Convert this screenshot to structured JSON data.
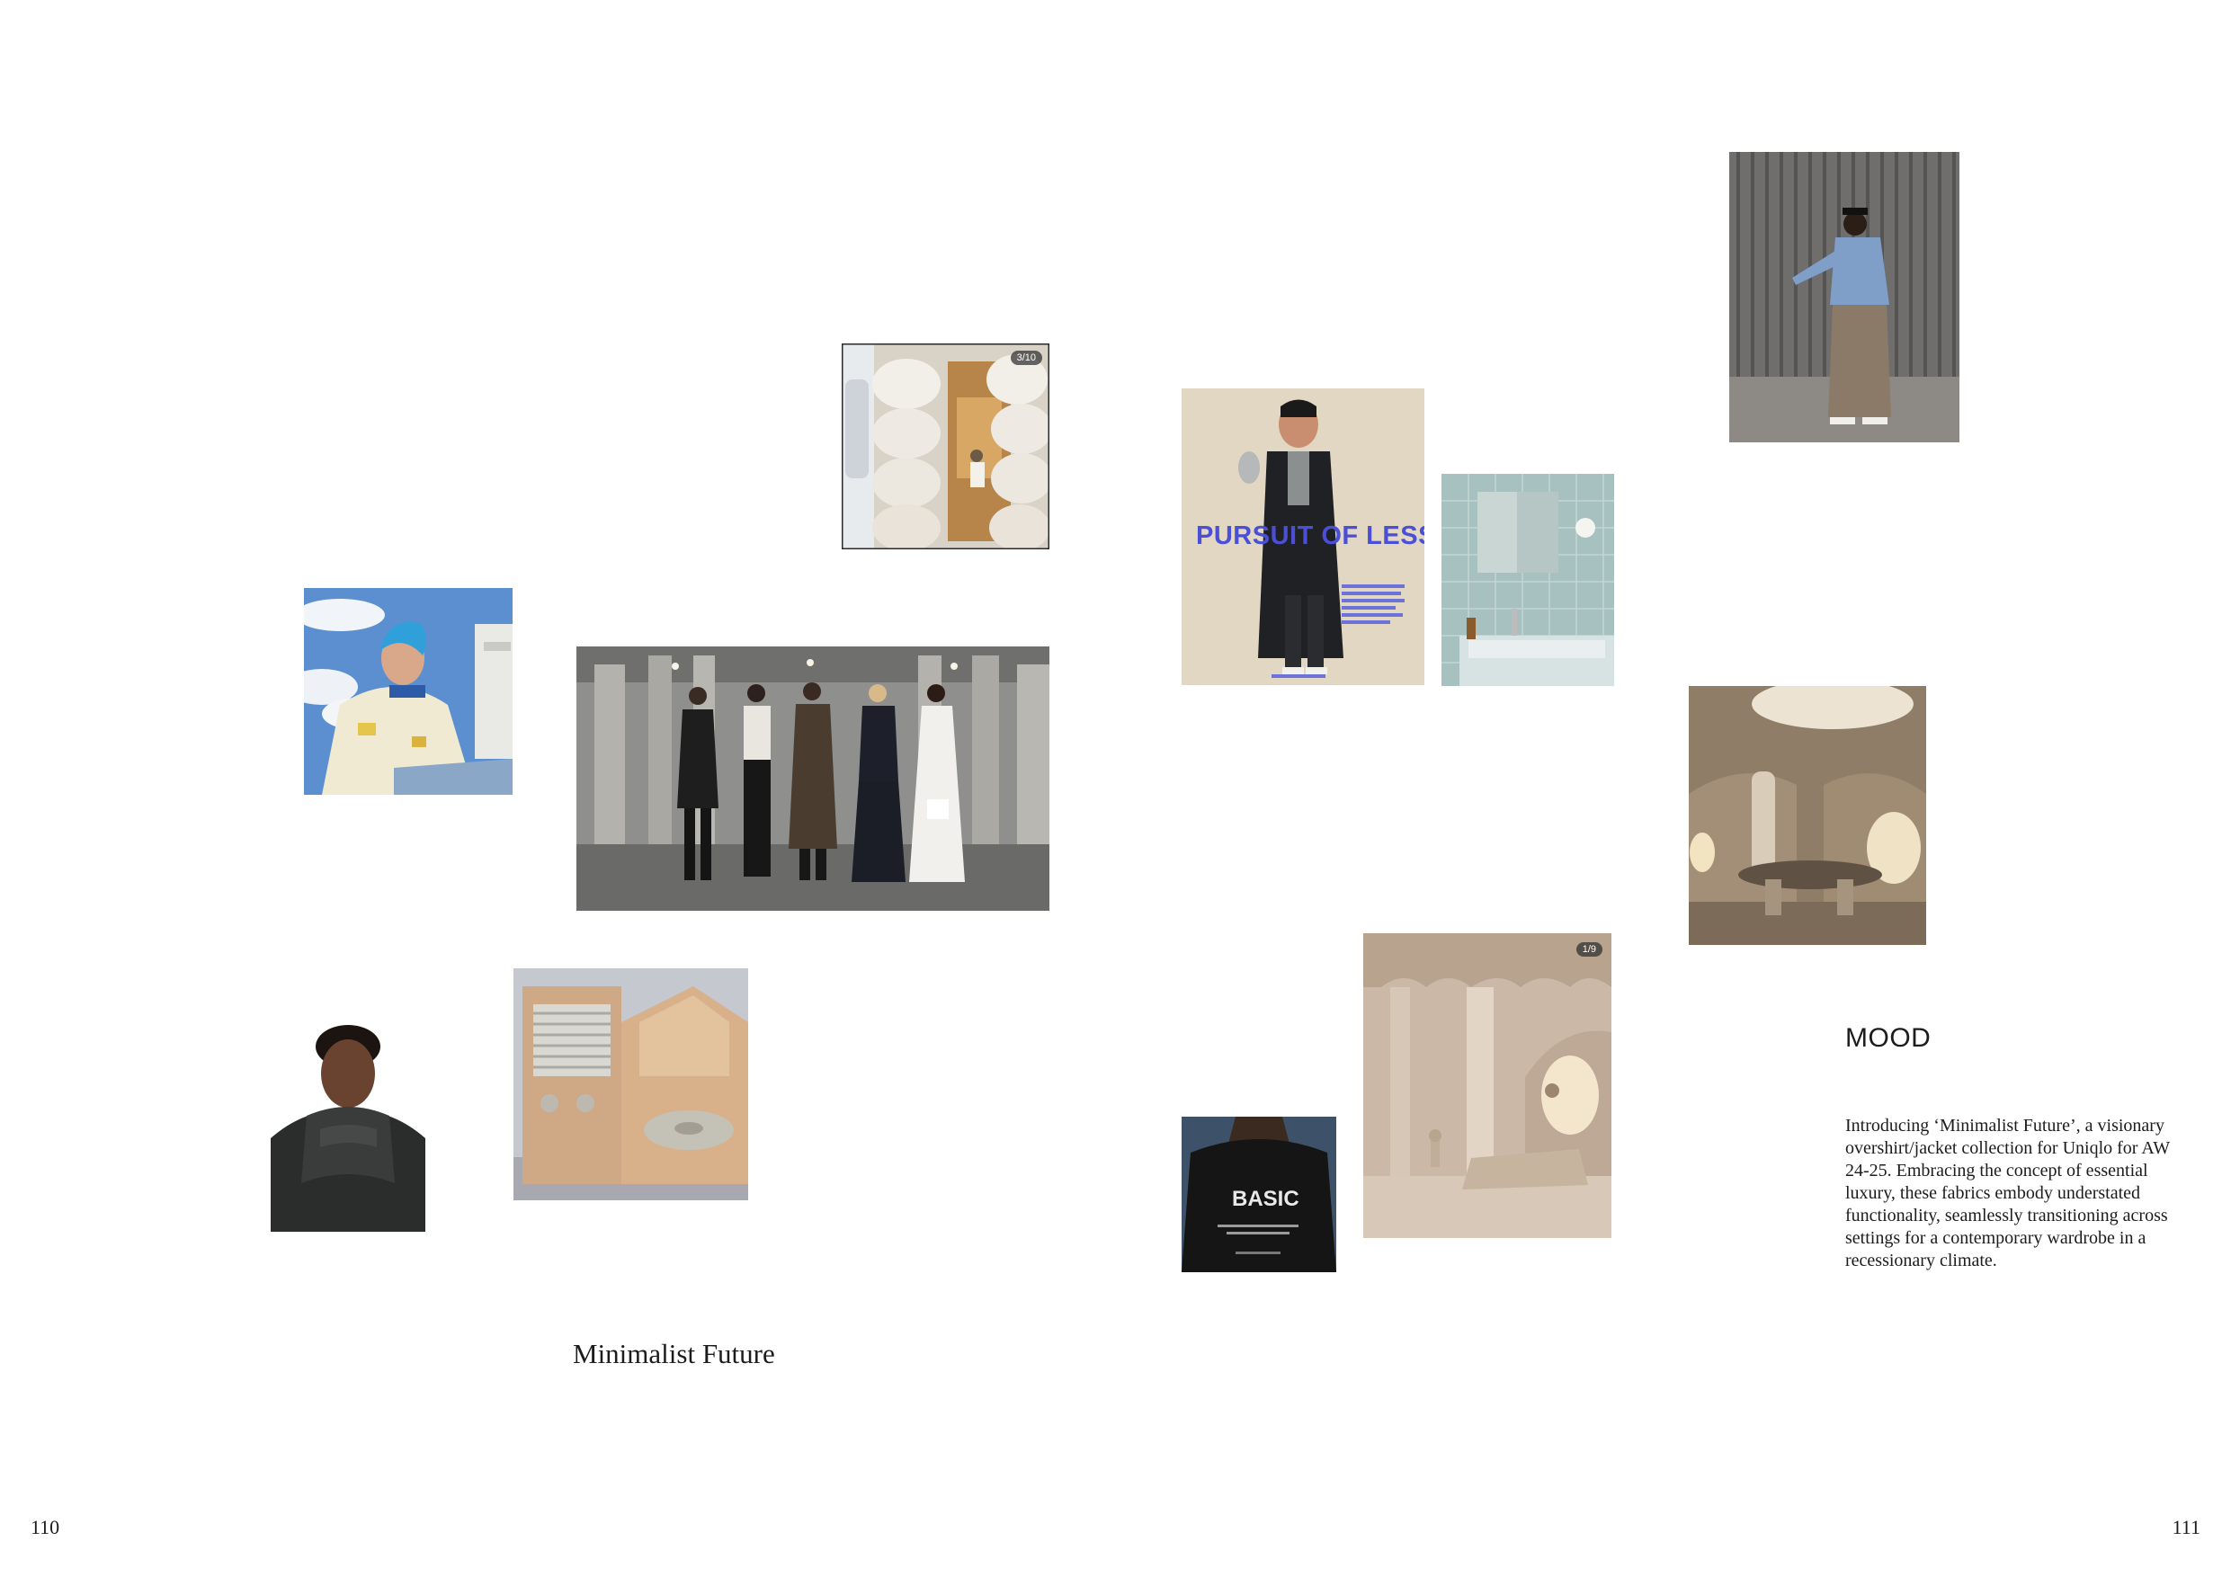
{
  "spread": {
    "title": "Minimalist Future",
    "mood_heading": "MOOD",
    "mood_body": "Introducing ‘Minimalist Future’, a visionary overshirt/jacket collection for Uniqlo for AW 24-25. Embracing the concept of essential luxury, these fabrics embody understated functionality, seamlessly transitioning across settings for a contemporary wardrobe in a recessionary climate.",
    "page_left": "110",
    "page_right": "111"
  },
  "photos": {
    "pod_counter": "3/10",
    "pursuit_headline": "PURSUIT OF LESS",
    "basic_text": "BASIC",
    "arches_counter": "1/9"
  },
  "colors": {
    "pursuit_blue": "#4a4fd6",
    "page_bg": "#ffffff",
    "text": "#1c1c1c"
  }
}
